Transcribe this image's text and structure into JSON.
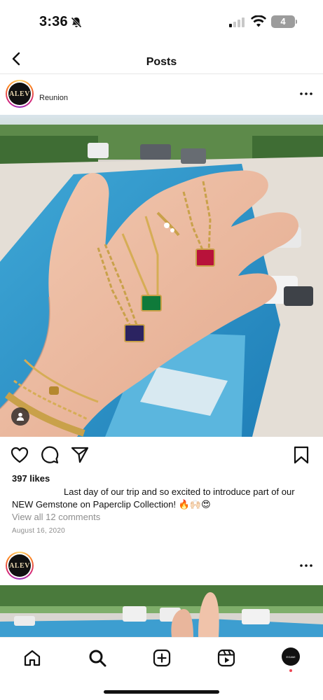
{
  "status_bar": {
    "time": "3:36",
    "battery_level": "4"
  },
  "header": {
    "title": "Posts"
  },
  "post": {
    "avatar_text": "ALEV",
    "location": "Reunion",
    "likes": "397 likes",
    "caption_line1": "Last day of our trip and so excited to introduce part of our",
    "caption_line2": "NEW Gemstone on Paperclip Collection! 🔥🙌🏻😍",
    "view_comments": "View all 12 comments",
    "date": "August 16, 2020"
  },
  "post2": {
    "avatar_text": "ALEV"
  },
  "tab_bar": {
    "profile_avatar_text": "EGAMI"
  },
  "icons": {
    "back": "chevron-left-icon",
    "more": "more-horizontal-icon",
    "like": "heart-icon",
    "comment": "comment-icon",
    "share": "send-icon",
    "save": "bookmark-icon",
    "tag": "person-tag-icon",
    "home": "home-icon",
    "search": "search-icon",
    "create": "plus-square-icon",
    "reels": "reels-icon"
  },
  "colors": {
    "text": "#111111",
    "secondary": "#8e8e8e",
    "notification_dot": "#ed4956"
  }
}
